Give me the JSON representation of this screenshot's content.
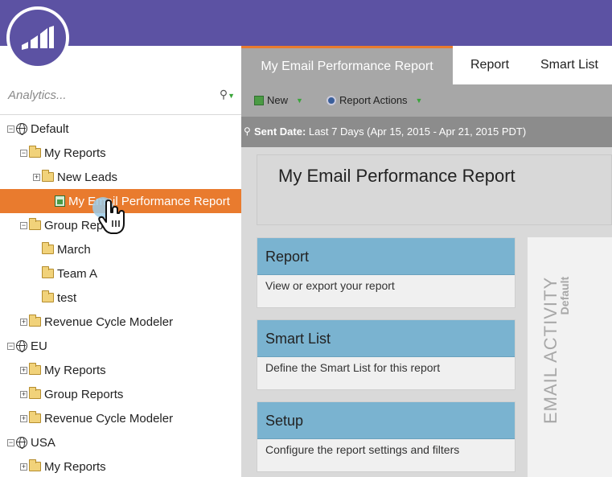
{
  "app": {
    "logo": "marketo-logo"
  },
  "left": {
    "search_label": "Analytics...",
    "tree": [
      {
        "label": "Default",
        "icon": "globe-icon",
        "toggle": "⊟",
        "indent": 0,
        "type": "globe"
      },
      {
        "label": "My Reports",
        "icon": "folder-icon",
        "toggle": "⊟",
        "indent": 1,
        "type": "folder"
      },
      {
        "label": "New Leads",
        "icon": "folder-icon",
        "toggle": "⊞",
        "indent": 2,
        "type": "folder"
      },
      {
        "label": "My Email Performance Report",
        "icon": "report-icon",
        "toggle": "",
        "indent": 3,
        "type": "report",
        "selected": true
      },
      {
        "label": "Group Rep",
        "icon": "folder-icon",
        "toggle": "⊟",
        "indent": 1,
        "type": "folder"
      },
      {
        "label": "March",
        "icon": "folder-icon",
        "toggle": "",
        "indent": 2,
        "type": "folder"
      },
      {
        "label": "Team A",
        "icon": "folder-icon",
        "toggle": "",
        "indent": 2,
        "type": "folder"
      },
      {
        "label": "test",
        "icon": "folder-icon",
        "toggle": "",
        "indent": 2,
        "type": "folder"
      },
      {
        "label": "Revenue Cycle Modeler",
        "icon": "folder-icon",
        "toggle": "⊞",
        "indent": 1,
        "type": "folder"
      },
      {
        "label": "EU",
        "icon": "globe-icon",
        "toggle": "⊟",
        "indent": 0,
        "type": "globe"
      },
      {
        "label": "My Reports",
        "icon": "folder-icon",
        "toggle": "⊞",
        "indent": 1,
        "type": "folder"
      },
      {
        "label": "Group Reports",
        "icon": "folder-icon",
        "toggle": "⊞",
        "indent": 1,
        "type": "folder"
      },
      {
        "label": "Revenue Cycle Modeler",
        "icon": "folder-icon",
        "toggle": "⊞",
        "indent": 1,
        "type": "folder"
      },
      {
        "label": "USA",
        "icon": "globe-icon",
        "toggle": "⊟",
        "indent": 0,
        "type": "globe"
      },
      {
        "label": "My Reports",
        "icon": "folder-icon",
        "toggle": "⊞",
        "indent": 1,
        "type": "folder"
      }
    ]
  },
  "tabs": [
    "My Email Performance Report",
    "Report",
    "Smart List"
  ],
  "toolbar": {
    "new_label": "New",
    "actions_label": "Report Actions"
  },
  "filter": {
    "key": "Sent Date:",
    "value": "Last 7 Days (Apr 15, 2015 - Apr 21, 2015 PDT)"
  },
  "report_title": "My Email Performance Report",
  "cards": [
    {
      "title": "Report",
      "desc": "View or export your report"
    },
    {
      "title": "Smart List",
      "desc": "Define the Smart List for this report"
    },
    {
      "title": "Setup",
      "desc": "Configure the report settings and filters"
    }
  ],
  "side": {
    "title": "EMAIL ACTIVITY",
    "subtitle": "Default"
  },
  "colors": {
    "header": "#5c52a3",
    "accent": "#e97b2e",
    "card_head": "#7ab3d0"
  }
}
